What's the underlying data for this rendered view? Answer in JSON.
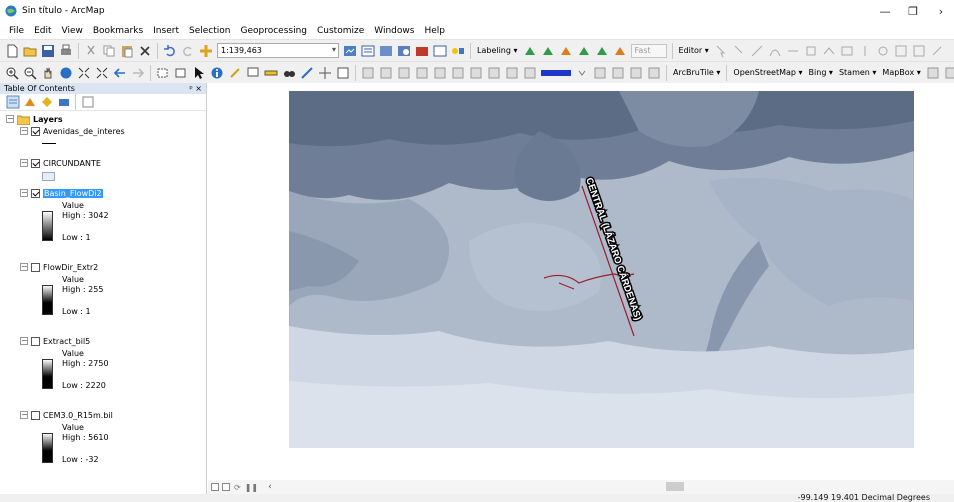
{
  "window": {
    "title": "Sin título - ArcMap"
  },
  "menu": [
    "File",
    "Edit",
    "View",
    "Bookmarks",
    "Insert",
    "Selection",
    "Geoprocessing",
    "Customize",
    "Windows",
    "Help"
  ],
  "toolbar": {
    "scale_value": "1:139,463",
    "labeling_label": "Labeling ▾",
    "fast_label": "Fast",
    "editor_label": "Editor ▾",
    "arcbrutile_label": "ArcBruTile ▾",
    "openstreetmap_label": "OpenStreetMap ▾",
    "bing_label": "Bing ▾",
    "stamen_label": "Stamen ▾",
    "mapbox_label": "MapBox ▾"
  },
  "toc": {
    "title": "Table Of Contents",
    "pin_icons": "ᵖ ×",
    "group_label": "Layers",
    "layers": [
      {
        "name": "Avenidas_de_interes",
        "checked": true
      },
      {
        "name": "CIRCUNDANTE",
        "checked": true
      },
      {
        "name": "Basin_FlowDi2",
        "checked": true,
        "selected": true,
        "value_label": "Value",
        "high": "High : 3042",
        "low": "Low : 1"
      },
      {
        "name": "FlowDir_Extr2",
        "checked": false,
        "value_label": "Value",
        "high": "High : 255",
        "low": "Low : 1"
      },
      {
        "name": "Extract_bil5",
        "checked": false,
        "value_label": "Value",
        "high": "High : 2750",
        "low": "Low : 2220"
      },
      {
        "name": "CEM3.0_R15m.bil",
        "checked": false,
        "value_label": "Value",
        "high": "High : 5610",
        "low": "Low : -32"
      }
    ]
  },
  "map": {
    "road_label": "CENTRAL (LÁZARO CÁRDENAS)"
  },
  "status": {
    "coordinates": "-99.149  19.401 Decimal Degrees"
  },
  "colors": {
    "accent_selected": "#3399ff",
    "road_line": "#9b1f2a",
    "title_bar": "#ffffff"
  }
}
